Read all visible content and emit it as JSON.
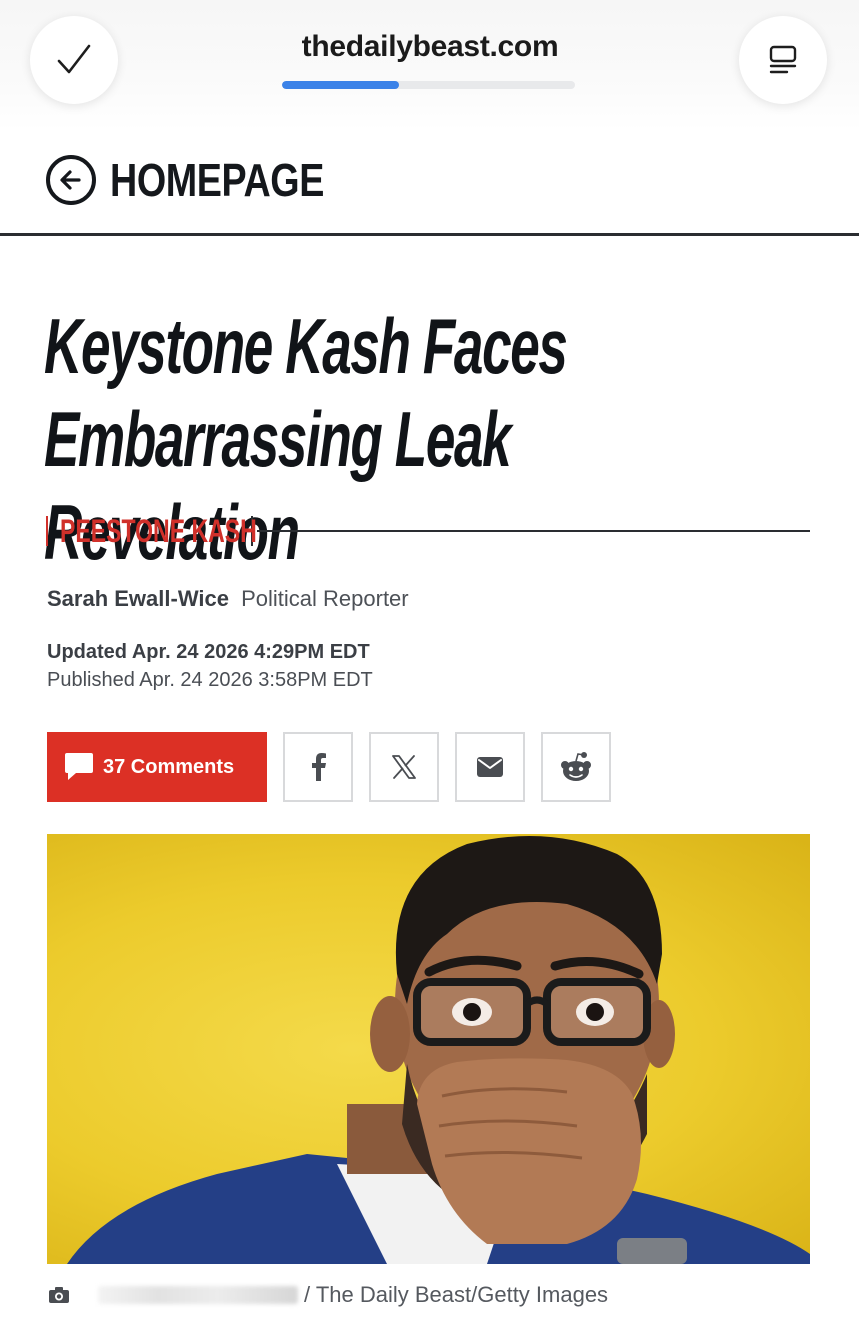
{
  "browser": {
    "url": "thedailybeast.com",
    "load_progress_percent": 40,
    "done_icon": "checkmark-icon",
    "reader_icon": "reader-mode-icon",
    "accent_color": "#3b82e8"
  },
  "nav": {
    "back_icon": "back-arrow-icon",
    "homepage_label": "HOMEPAGE"
  },
  "article": {
    "headline": "Keystone Kash Faces Embarrassing Leak Revelation",
    "rubric": "PEESTONE KASH",
    "author": "Sarah Ewall-Wice",
    "author_role": "Political Reporter",
    "updated": "Updated Apr. 24 2026 4:29PM EDT",
    "published": "Published Apr. 24 2026 3:58PM EDT",
    "brand_red": "#dc3025"
  },
  "share": {
    "comments_label": "37 Comments",
    "comment_icon": "comment-bubble-icon",
    "facebook_icon": "facebook-icon",
    "x_icon": "x-icon",
    "email_icon": "email-icon",
    "reddit_icon": "reddit-icon"
  },
  "hero": {
    "image_icon": "photo-of-man-covering-mouth",
    "background_color": "#eccb2c"
  },
  "caption": {
    "camera_icon": "camera-icon",
    "credit": "/ The Daily Beast/Getty Images"
  }
}
